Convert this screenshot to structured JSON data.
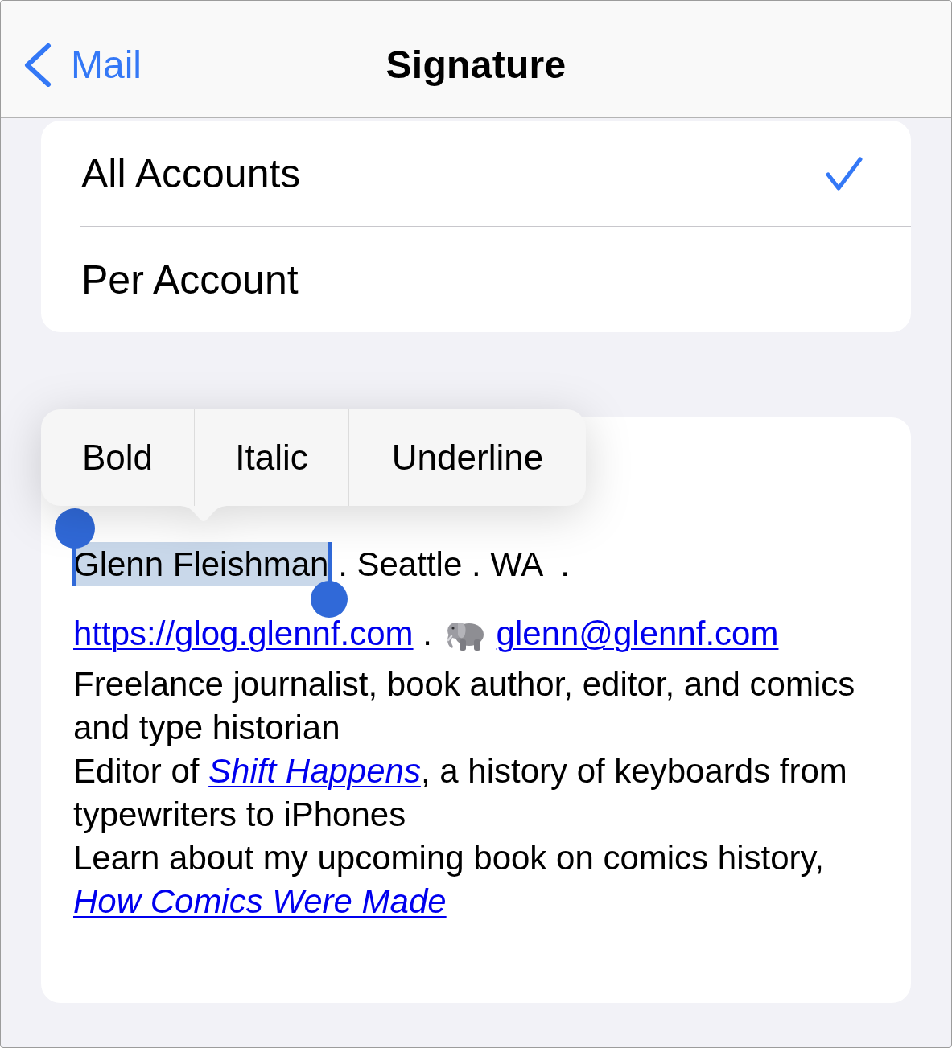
{
  "nav_bar": {
    "back_label": "Mail",
    "title": "Signature"
  },
  "scope_options": [
    {
      "label": "All Accounts",
      "selected": true
    },
    {
      "label": "Per Account",
      "selected": false
    }
  ],
  "format_menu": {
    "items": [
      "Bold",
      "Italic",
      "Underline"
    ]
  },
  "signature": {
    "paragraphs": [
      {
        "segments": [
          {
            "kind": "selection",
            "text": "Glenn Fleishman"
          },
          {
            "kind": "text",
            "text": " . Seattle . WA  ."
          }
        ]
      },
      {
        "segments": [
          {
            "kind": "link",
            "text": "https://glog.glennf.com",
            "italic": false
          },
          {
            "kind": "text",
            "text": " . "
          },
          {
            "kind": "emoji"
          },
          {
            "kind": "link",
            "text": "glenn@glennf.com",
            "italic": false
          }
        ]
      },
      {
        "segments": [
          {
            "kind": "text",
            "text": "Freelance journalist, book author, editor, and comics and type historian"
          }
        ]
      },
      {
        "segments": [
          {
            "kind": "text",
            "text": "Editor of "
          },
          {
            "kind": "link",
            "text": "Shift Happens",
            "italic": true
          },
          {
            "kind": "text",
            "text": ", a history of keyboards from typewriters to iPhones"
          }
        ]
      },
      {
        "segments": [
          {
            "kind": "text",
            "text": "Learn about my upcoming book on comics history, "
          },
          {
            "kind": "link",
            "text": "How Comics Were Made",
            "italic": true
          }
        ]
      }
    ]
  }
}
